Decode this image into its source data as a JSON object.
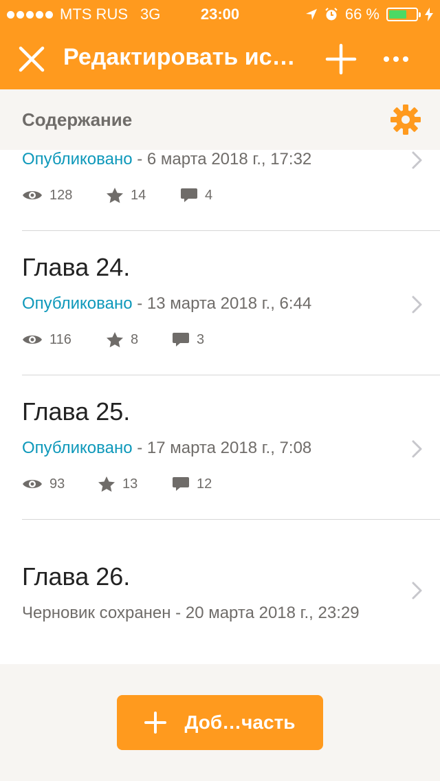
{
  "status_bar": {
    "carrier": "MTS RUS",
    "network": "3G",
    "time": "23:00",
    "battery": "66 %",
    "battery_level": 0.66
  },
  "nav": {
    "title": "Редактировать ис…"
  },
  "section": {
    "title": "Содержание"
  },
  "chapters": [
    {
      "title": "",
      "status": "Опубликовано",
      "date": " - 6 марта 2018 г., 17:32",
      "views": "128",
      "stars": "14",
      "comments": "4"
    },
    {
      "title": "Глава 24.",
      "status": "Опубликовано",
      "date": " - 13 марта 2018 г., 6:44",
      "views": "116",
      "stars": "8",
      "comments": "3"
    },
    {
      "title": "Глава 25.",
      "status": "Опубликовано",
      "date": " - 17 марта 2018 г., 7:08",
      "views": "93",
      "stars": "13",
      "comments": "12"
    },
    {
      "title": "Глава 26.",
      "draft_status": "Черновик сохранен - 20 марта 2018 г., 23:29"
    }
  ],
  "footer": {
    "add_button_label": "Доб…часть"
  },
  "colors": {
    "accent": "#ff9a1e",
    "published": "#0d98ba",
    "muted": "#6f6c69"
  }
}
